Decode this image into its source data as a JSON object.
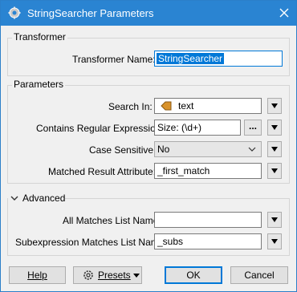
{
  "window": {
    "title": "StringSearcher Parameters",
    "icons": {
      "app": "wrench-cog-icon",
      "close": "close-icon"
    }
  },
  "transformer_group": {
    "legend": "Transformer",
    "name_label": "Transformer Name:",
    "name_value": "StringSearcher"
  },
  "parameters_group": {
    "legend": "Parameters",
    "search_in_label": "Search In:",
    "search_in_value": "text",
    "search_in_icon": "attribute-tag-icon",
    "regex_label": "Contains Regular Expression:",
    "regex_value": "Size: (\\d+)",
    "regex_editor_button": "...",
    "case_label": "Case Sensitive:",
    "case_value": "No",
    "matched_label": "Matched Result Attribute:",
    "matched_value": "_first_match"
  },
  "advanced_group": {
    "legend": "Advanced",
    "expanded": true,
    "all_matches_label": "All Matches List Name:",
    "all_matches_value": "",
    "subexpr_label": "Subexpression Matches List Name:",
    "subexpr_value": "_subs"
  },
  "footer": {
    "help": "Help",
    "presets": "Presets",
    "ok": "OK",
    "cancel": "Cancel"
  }
}
